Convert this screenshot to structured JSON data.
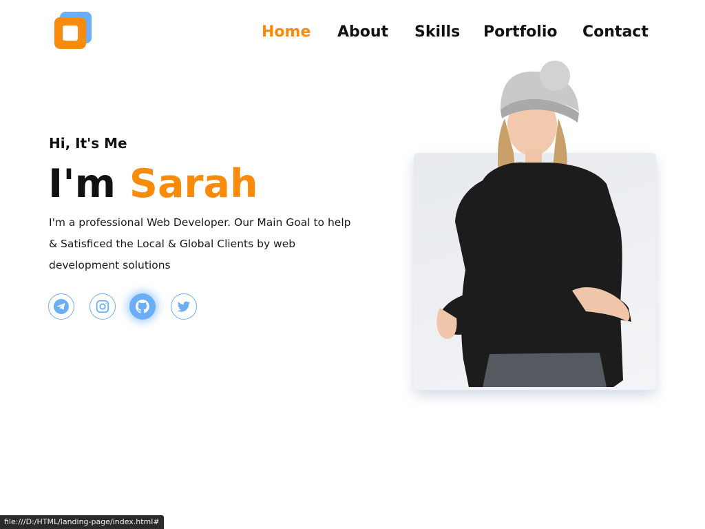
{
  "nav": {
    "items": [
      {
        "label": "Home",
        "active": true
      },
      {
        "label": "About",
        "active": false
      },
      {
        "label": "Skills",
        "active": false
      },
      {
        "label": "Portfolio",
        "active": false
      },
      {
        "label": "Contact",
        "active": false
      }
    ]
  },
  "hero": {
    "greeting": "Hi, It's Me",
    "title_prefix": "I'm ",
    "title_name": "Sarah",
    "description": "I'm a professional Web Developer. Our Main Goal to help & Satisficed the Local & Global Clients by web development solutions"
  },
  "socials": [
    {
      "icon": "telegram-icon",
      "active": false
    },
    {
      "icon": "instagram-icon",
      "active": false
    },
    {
      "icon": "github-icon",
      "active": true
    },
    {
      "icon": "twitter-icon",
      "active": false
    }
  ],
  "status_bar": {
    "url": "file:///D:/HTML/landing-page/index.html#"
  },
  "colors": {
    "accent": "#f88a0c",
    "secondary": "#6aaef7",
    "text": "#111111",
    "background": "#ffffff"
  }
}
